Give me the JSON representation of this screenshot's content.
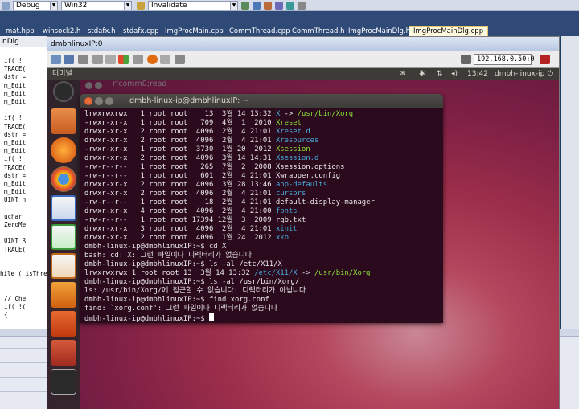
{
  "vs_toolbar": {
    "config": "Debug",
    "platform": "Win32",
    "function": "Invalidate"
  },
  "vs_tabs": [
    {
      "label": "mat.hpp",
      "active": false
    },
    {
      "label": "winsock2.h",
      "active": false
    },
    {
      "label": "stdafx.h",
      "active": false
    },
    {
      "label": "stdafx.cpp",
      "active": false
    },
    {
      "label": "ImgProcMain.cpp",
      "active": false
    },
    {
      "label": "CommThread.cpp",
      "active": false
    },
    {
      "label": "CommThread.h",
      "active": false
    },
    {
      "label": "ImgProcMainDlg.h",
      "active": false
    },
    {
      "label": "ImgProcMainDlg.cpp",
      "active": true
    }
  ],
  "vs_editor": {
    "header": "nDlg",
    "lines": [
      "if( !",
      "TRACE(",
      "dstr =",
      "m_Edit",
      "m_Edit",
      "m_Edit",
      "",
      "if( !",
      "TRACE(",
      "dstr =",
      "m_Edit",
      "m_Edit",
      "if( !",
      "TRACE(",
      "dstr =",
      "m_Edit",
      "m_Edit",
      "UINT n",
      "",
      "uchar",
      "ZeroMe",
      "",
      "UINT R",
      "TRACE(",
      "",
      "",
      "hile ( isThre",
      "",
      "",
      "// Che",
      "if( !(",
      "{"
    ]
  },
  "viewer": {
    "title": "dmbhlinuxIP:0",
    "ip": "192.168.0.50:0"
  },
  "ubuntu": {
    "panel_title": "터미널",
    "clock": "13:42",
    "host": "dmbh-linux-ip"
  },
  "ghost_title": "rfcomm0;read",
  "terminal": {
    "title": "dmbh-linux-ip@dmbhlinuxIP: ~",
    "lines": [
      [
        {
          "t": "lrwxrwxrwx   1 root root    13  3월 14 13:32 ",
          "c": "white"
        },
        {
          "t": "X",
          "c": "cyan"
        },
        {
          "t": " -> ",
          "c": "white"
        },
        {
          "t": "/usr/bin/Xorg",
          "c": "green"
        }
      ],
      [
        {
          "t": "-rwxr-xr-x   1 root root   709  4월  1  2010 ",
          "c": "white"
        },
        {
          "t": "Xreset",
          "c": "green"
        }
      ],
      [
        {
          "t": "drwxr-xr-x   2 root root  4096  2월  4 21:01 ",
          "c": "white"
        },
        {
          "t": "Xreset.d",
          "c": "cyan"
        }
      ],
      [
        {
          "t": "drwxr-xr-x   2 root root  4096  2월  4 21:01 ",
          "c": "white"
        },
        {
          "t": "Xresources",
          "c": "cyan"
        }
      ],
      [
        {
          "t": "-rwxr-xr-x   1 root root  3730  1월 20  2012 ",
          "c": "white"
        },
        {
          "t": "Xsession",
          "c": "green"
        }
      ],
      [
        {
          "t": "drwxr-xr-x   2 root root  4096  3월 14 14:31 ",
          "c": "white"
        },
        {
          "t": "Xsession.d",
          "c": "cyan"
        }
      ],
      [
        {
          "t": "-rw-r--r--   1 root root   265  7월  2  2008 Xsession.options",
          "c": "white"
        }
      ],
      [
        {
          "t": "-rw-r--r--   1 root root   601  2월  4 21:01 Xwrapper.config",
          "c": "white"
        }
      ],
      [
        {
          "t": "drwxr-xr-x   2 root root  4096  3월 28 13:46 ",
          "c": "white"
        },
        {
          "t": "app-defaults",
          "c": "cyan"
        }
      ],
      [
        {
          "t": "drwxr-xr-x   2 root root  4096  2월  4 21:01 ",
          "c": "white"
        },
        {
          "t": "cursors",
          "c": "cyan"
        }
      ],
      [
        {
          "t": "-rw-r--r--   1 root root    18  2월  4 21:01 default-display-manager",
          "c": "white"
        }
      ],
      [
        {
          "t": "drwxr-xr-x   4 root root  4096  2월  4 21:00 ",
          "c": "white"
        },
        {
          "t": "fonts",
          "c": "cyan"
        }
      ],
      [
        {
          "t": "-rw-r--r--   1 root root 17394 12월  3  2009 rgb.txt",
          "c": "white"
        }
      ],
      [
        {
          "t": "drwxr-xr-x   3 root root  4096  2월  4 21:01 ",
          "c": "white"
        },
        {
          "t": "xinit",
          "c": "cyan"
        }
      ],
      [
        {
          "t": "drwxr-xr-x   2 root root  4096  1월 24  2012 ",
          "c": "white"
        },
        {
          "t": "xkb",
          "c": "cyan"
        }
      ],
      [
        {
          "t": "dmbh-linux-ip@dmbhlinuxIP:~$ cd X",
          "c": "white"
        }
      ],
      [
        {
          "t": "bash: cd: X: 그런 파일이나 디렉터리가 없습니다",
          "c": "white"
        }
      ],
      [
        {
          "t": "dmbh-linux-ip@dmbhlinuxIP:~$ ls -al /etc/X11/X",
          "c": "white"
        }
      ],
      [
        {
          "t": "lrwxrwxrwx 1 root root 13  3월 14 13:32 ",
          "c": "white"
        },
        {
          "t": "/etc/X11/X",
          "c": "cyan"
        },
        {
          "t": " -> ",
          "c": "white"
        },
        {
          "t": "/usr/bin/Xorg",
          "c": "green"
        }
      ],
      [
        {
          "t": "dmbh-linux-ip@dmbhlinuxIP:~$ ls -al /usr/bin/Xorg/",
          "c": "white"
        }
      ],
      [
        {
          "t": "ls: /usr/bin/Xorg/에 접근할 수 없습니다: 디렉터리가 아닙니다",
          "c": "white"
        }
      ],
      [
        {
          "t": "dmbh-linux-ip@dmbhlinuxIP:~$ find xorg.conf",
          "c": "white"
        }
      ],
      [
        {
          "t": "find: `xorg.conf': 그런 파일이나 디렉터리가 없습니다",
          "c": "white"
        }
      ],
      [
        {
          "t": "dmbh-linux-ip@dmbhlinuxIP:~$ ",
          "c": "white"
        }
      ]
    ]
  },
  "colors": {
    "terminal_bg": "#2c0a1e",
    "cyan": "#46a8d8",
    "green": "#8ae234",
    "panel": "#3c3b37"
  }
}
